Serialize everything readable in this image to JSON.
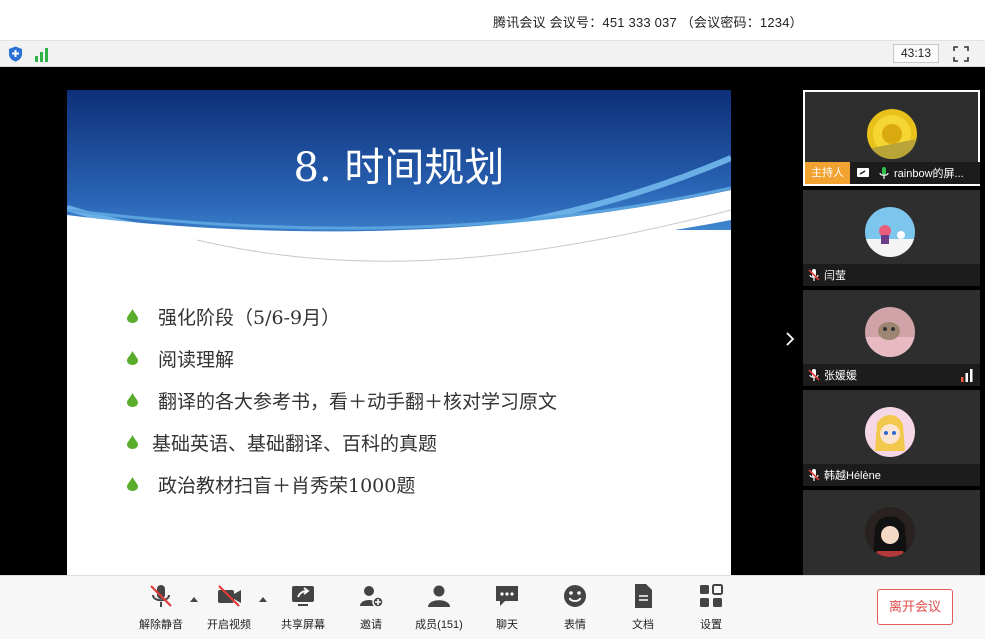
{
  "window": {
    "title": "腾讯会议 会议号：451 333 037 （会议密码：1234）"
  },
  "status": {
    "timer": "43:13"
  },
  "slide": {
    "title": "8. 时间规划",
    "bullets": [
      "强化阶段（5/6-9月）",
      "阅读理解",
      "翻译的各大参考书，看＋动手翻＋核对学习原文",
      "基础英语、基础翻译、百科的真题",
      "政治教材扫盲＋肖秀荣1000题"
    ]
  },
  "participants": [
    {
      "name": "rainbow的屏...",
      "host_label": "主持人",
      "mic": "on"
    },
    {
      "name": "闫莹",
      "mic": "muted"
    },
    {
      "name": "张媛媛",
      "mic": "muted"
    },
    {
      "name": "韩越Hélène",
      "mic": "muted"
    }
  ],
  "toolbar": {
    "unmute": "解除静音",
    "start_video": "开启视频",
    "share_screen": "共享屏幕",
    "invite": "邀请",
    "members": "成员(151)",
    "chat": "聊天",
    "reactions": "表情",
    "docs": "文档",
    "settings": "设置",
    "leave": "离开会议"
  },
  "colors": {
    "host_badge": "#f2a230",
    "leave_text": "#e04a4a",
    "slide_blue": "#1f5aa8",
    "bullet_green": "#5aac2c"
  }
}
